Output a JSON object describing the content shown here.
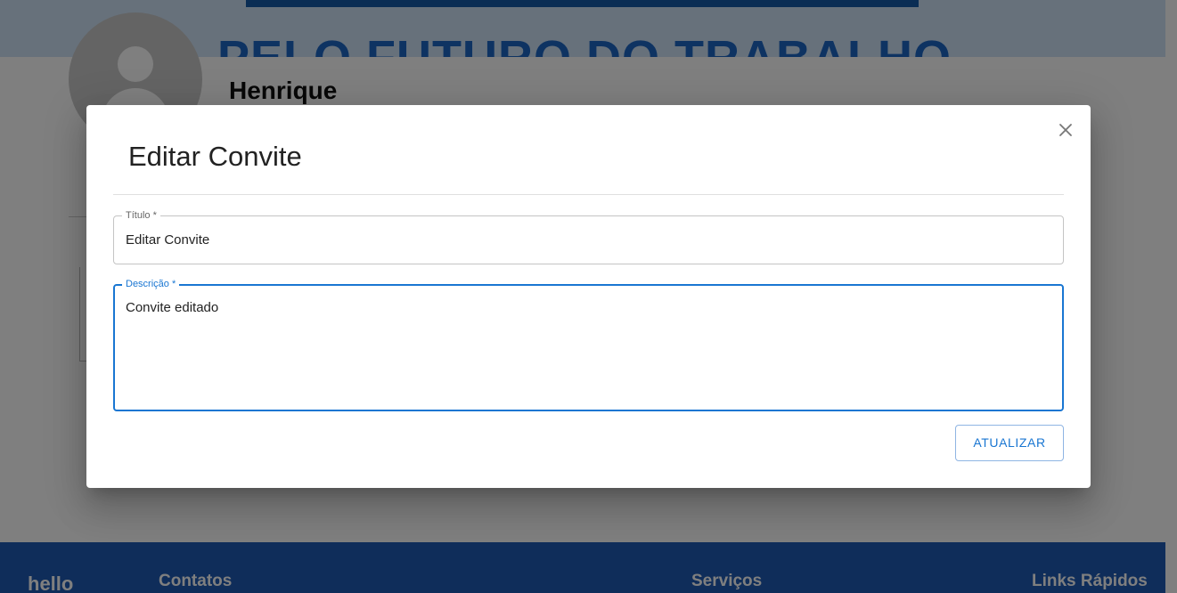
{
  "background": {
    "banner_text": "PELO FUTURO DO TRABALHO",
    "user_name": "Henrique"
  },
  "footer": {
    "logo": "hello",
    "headings": [
      "Contatos",
      "Serviços",
      "Links Rápidos"
    ]
  },
  "modal": {
    "title": "Editar Convite",
    "close_icon": "close-icon",
    "fields": {
      "titulo": {
        "label": "Título *",
        "value": "Editar Convite"
      },
      "descricao": {
        "label": "Descrição *",
        "value": "Convite editado"
      }
    },
    "submit_label": "ATUALIZAR"
  },
  "colors": {
    "accent": "#1976d2",
    "footer": "#1f5bb5",
    "banner_text": "#1d66c4"
  }
}
